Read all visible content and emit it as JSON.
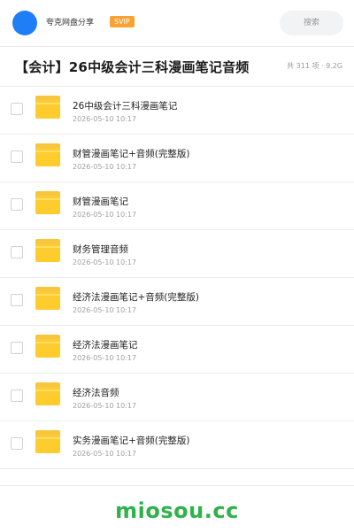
{
  "topbar": {
    "app_name": "夸克网盘分享",
    "badge": "SVIP",
    "search_label": "搜索",
    "avatar_color": "#1f7ef6",
    "badge_color": "#f7a233"
  },
  "header": {
    "title": "【会计】26中级会计三科漫画笔记音频",
    "meta": "共 311 项 · 9.2G"
  },
  "items": [
    {
      "name": "26中级会计三科漫画笔记",
      "date": "2026-05-10 10:17",
      "icon": "folder-icon"
    },
    {
      "name": "财管漫画笔记+音频(完整版)",
      "date": "2026-05-10 10:17",
      "icon": "folder-icon"
    },
    {
      "name": "财管漫画笔记",
      "date": "2026-05-10 10:17",
      "icon": "folder-icon"
    },
    {
      "name": "财务管理音频",
      "date": "2026-05-10 10:17",
      "icon": "folder-icon"
    },
    {
      "name": "经济法漫画笔记+音频(完整版)",
      "date": "2026-05-10 10:17",
      "icon": "folder-icon"
    },
    {
      "name": "经济法漫画笔记",
      "date": "2026-05-10 10:17",
      "icon": "folder-icon"
    },
    {
      "name": "经济法音频",
      "date": "2026-05-10 10:17",
      "icon": "folder-icon"
    },
    {
      "name": "实务漫画笔记+音频(完整版)",
      "date": "2026-05-10 10:17",
      "icon": "folder-icon"
    }
  ],
  "footer": {
    "watermark": "miosou.cc",
    "watermark_color": "#2fb24c"
  }
}
